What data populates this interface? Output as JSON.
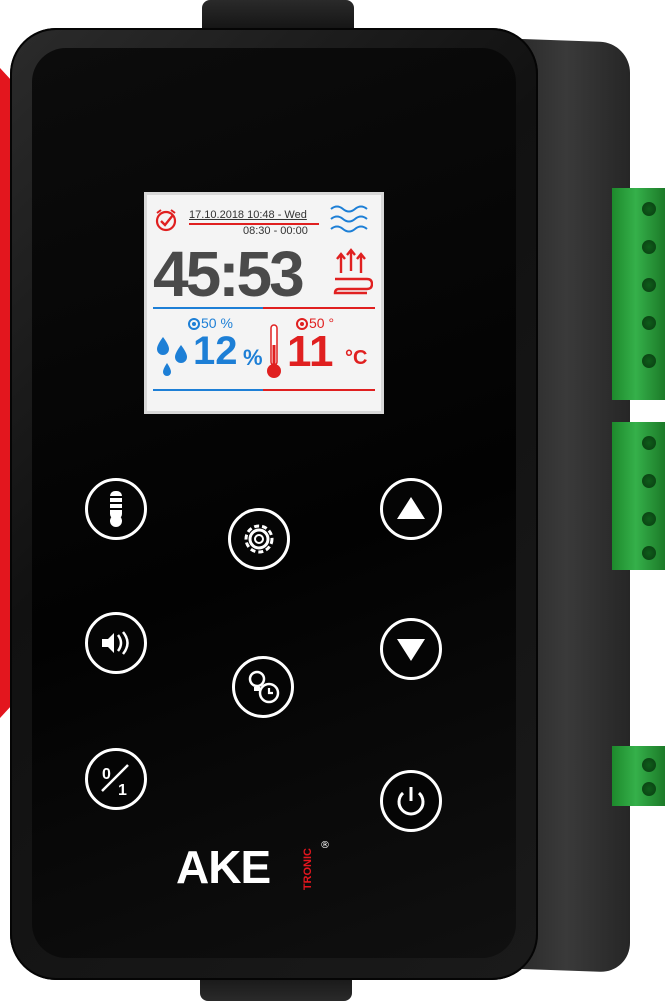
{
  "display": {
    "datetime": "17.10.2018 10:48 - Wed",
    "schedule": "08:30 - 00:00",
    "timer": "45:53",
    "humidity_setpoint": "50 %",
    "humidity_value": "12",
    "humidity_unit": "%",
    "temperature_setpoint": "50 °",
    "temperature_value": "11",
    "temperature_unit": "°C"
  },
  "brand": {
    "logo": "AKE",
    "sub": "TRONIC",
    "registered": "®"
  },
  "buttons": [
    {
      "name": "humidifier-button",
      "icon": "humidifier-icon"
    },
    {
      "name": "settings-button",
      "icon": "gear-icon"
    },
    {
      "name": "up-button",
      "icon": "triangle-up-icon"
    },
    {
      "name": "fan-button",
      "icon": "fan-sound-icon"
    },
    {
      "name": "light-timer-button",
      "icon": "bulb-clock-icon"
    },
    {
      "name": "down-button",
      "icon": "triangle-down-icon"
    },
    {
      "name": "toggle-button",
      "icon": "zero-one-icon"
    },
    {
      "name": "power-button",
      "icon": "power-icon"
    }
  ],
  "colors": {
    "humidity": "#1d7fd6",
    "temperature": "#e02020",
    "brand_red": "#e3161e",
    "terminal_green": "#2fa844"
  }
}
